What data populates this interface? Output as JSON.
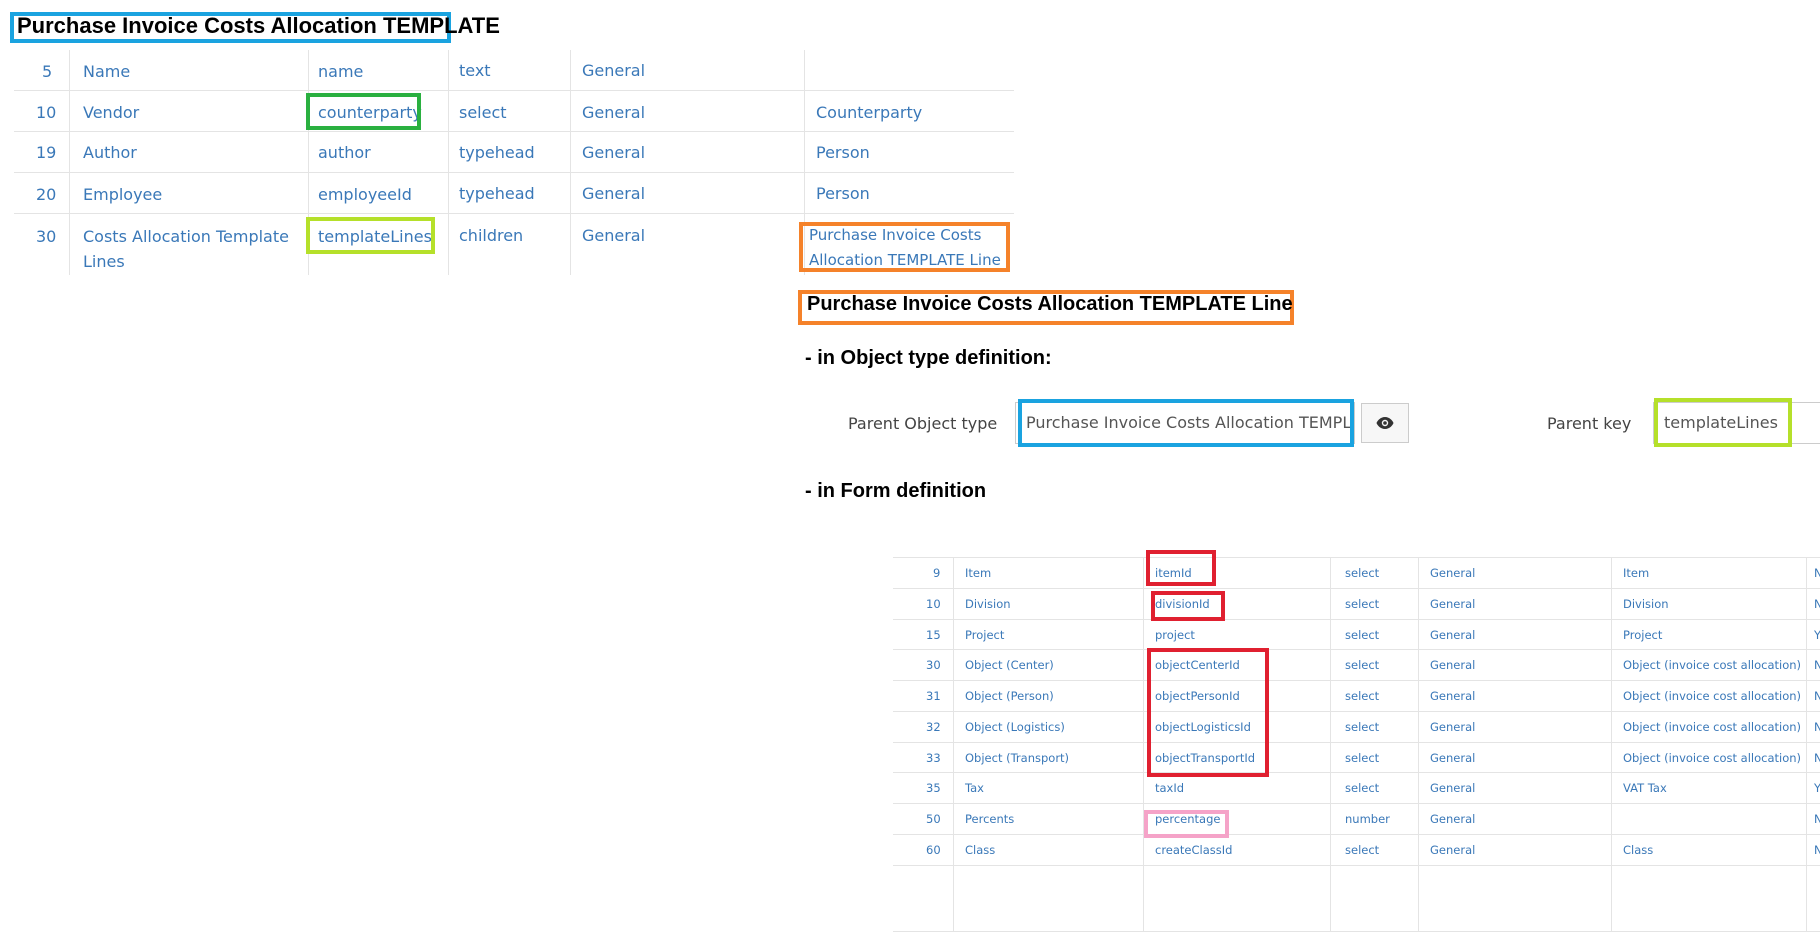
{
  "top_header": "Purchase Invoice Costs Allocation TEMPLATE",
  "top_table": {
    "rows": [
      {
        "no": "5",
        "label": "Name",
        "key": "name",
        "type": "text",
        "group": "General",
        "ref": ""
      },
      {
        "no": "10",
        "label": "Vendor",
        "key": "counterparty",
        "type": "select",
        "group": "General",
        "ref": "Counterparty"
      },
      {
        "no": "19",
        "label": "Author",
        "key": "author",
        "type": "typehead",
        "group": "General",
        "ref": "Person"
      },
      {
        "no": "20",
        "label": "Employee",
        "key": "employeeId",
        "type": "typehead",
        "group": "General",
        "ref": "Person"
      },
      {
        "no": "30",
        "label_line1": "Costs Allocation Template",
        "label_line2": "Lines",
        "key": "templateLines",
        "type": "children",
        "group": "General",
        "ref_line1": "Purchase Invoice Costs",
        "ref_line2": "Allocation TEMPLATE Line"
      }
    ]
  },
  "line_header": "Purchase Invoice Costs Allocation TEMPLATE Line",
  "object_type_heading": "- in Object type definition:",
  "object_type": {
    "parent_label": "Parent Object type",
    "parent_value": "Purchase Invoice Costs Allocation TEMPLATE",
    "parent_key_label": "Parent key",
    "parent_key_value": "templateLines"
  },
  "form_heading": "- in Form definition",
  "form_table": {
    "rows": [
      {
        "no": "9",
        "label": "Item",
        "key": "itemId",
        "type": "select",
        "group": "General",
        "ref": "Item",
        "flag": "N"
      },
      {
        "no": "10",
        "label": "Division",
        "key": "divisionId",
        "type": "select",
        "group": "General",
        "ref": "Division",
        "flag": "N"
      },
      {
        "no": "15",
        "label": "Project",
        "key": "project",
        "type": "select",
        "group": "General",
        "ref": "Project",
        "flag": "Y"
      },
      {
        "no": "30",
        "label": "Object (Center)",
        "key": "objectCenterId",
        "type": "select",
        "group": "General",
        "ref": "Object (invoice cost allocation)",
        "flag": "N"
      },
      {
        "no": "31",
        "label": "Object (Person)",
        "key": "objectPersonId",
        "type": "select",
        "group": "General",
        "ref": "Object (invoice cost allocation)",
        "flag": "N"
      },
      {
        "no": "32",
        "label": "Object (Logistics)",
        "key": "objectLogisticsId",
        "type": "select",
        "group": "General",
        "ref": "Object (invoice cost allocation)",
        "flag": "N"
      },
      {
        "no": "33",
        "label": "Object (Transport)",
        "key": "objectTransportId",
        "type": "select",
        "group": "General",
        "ref": "Object (invoice cost allocation)",
        "flag": "N"
      },
      {
        "no": "35",
        "label": "Tax",
        "key": "taxId",
        "type": "select",
        "group": "General",
        "ref": "VAT Tax",
        "flag": "Y"
      },
      {
        "no": "50",
        "label": "Percents",
        "key": "percentage",
        "type": "number",
        "group": "General",
        "ref": "",
        "flag": "N"
      },
      {
        "no": "60",
        "label": "Class",
        "key": "createClassId",
        "type": "select",
        "group": "General",
        "ref": "Class",
        "flag": "N"
      }
    ]
  },
  "colors": {
    "blue": "#1aa3e0",
    "orange": "#f5822a",
    "green": "#2ab040",
    "lime": "#b5e02a",
    "red": "#e02030",
    "pink": "#f5a3c8",
    "link_text": "#3a78b8"
  },
  "icons": {
    "view": "eye-icon"
  }
}
